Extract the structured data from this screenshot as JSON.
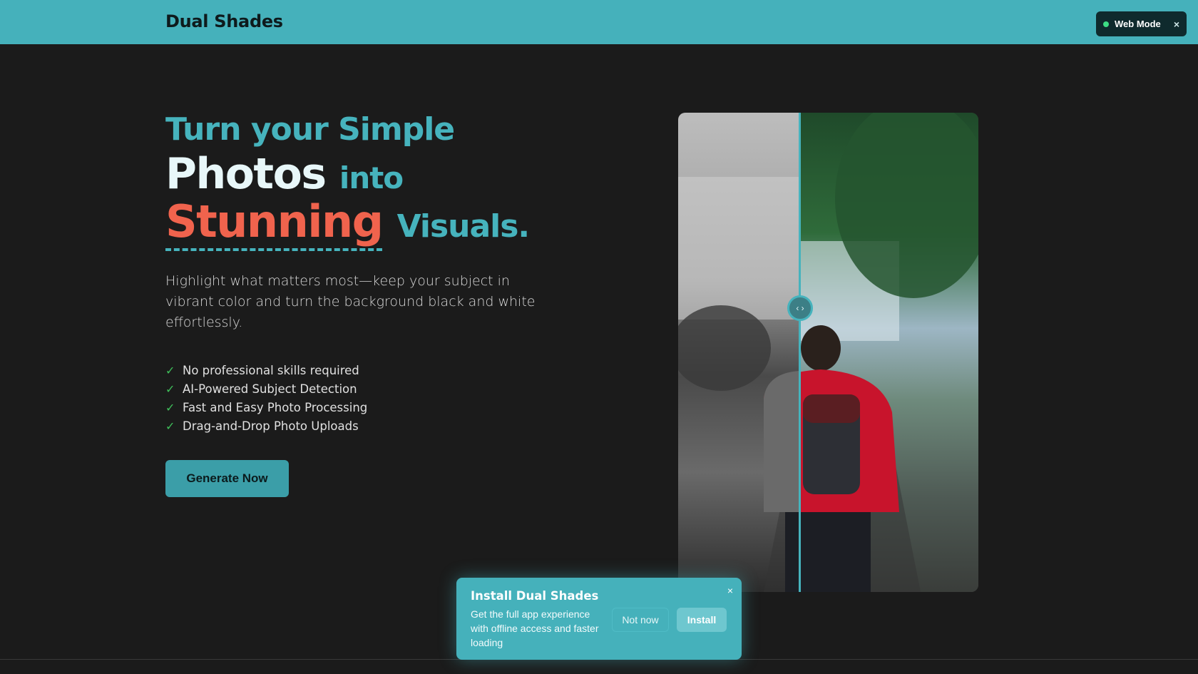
{
  "header": {
    "brand": "Dual Shades",
    "mode_label": "Web Mode",
    "mode_close": "×"
  },
  "hero": {
    "line1": "Turn your Simple",
    "line2_big": "Photos",
    "line2_small": "into",
    "line3_big": "Stunning",
    "line3_small": "Visuals.",
    "description": "Highlight what matters most—keep your subject in vibrant color and turn the background black and white effortlessly.",
    "features": [
      "No professional skills required",
      "AI-Powered Subject Detection",
      "Fast and Easy Photo Processing",
      "Drag-and-Drop Photo Uploads"
    ],
    "cta_label": "Generate Now"
  },
  "comparison": {
    "handle_glyphs": "‹ ›",
    "split_fraction": 0.405
  },
  "install_prompt": {
    "title": "Install Dual Shades",
    "body": "Get the full app experience with offline access and faster loading",
    "not_now_label": "Not now",
    "install_label": "Install",
    "close": "×"
  },
  "colors": {
    "accent": "#46b3bd",
    "highlight": "#f0634d",
    "background": "#1b1b1b",
    "check": "#3fbf5a"
  }
}
